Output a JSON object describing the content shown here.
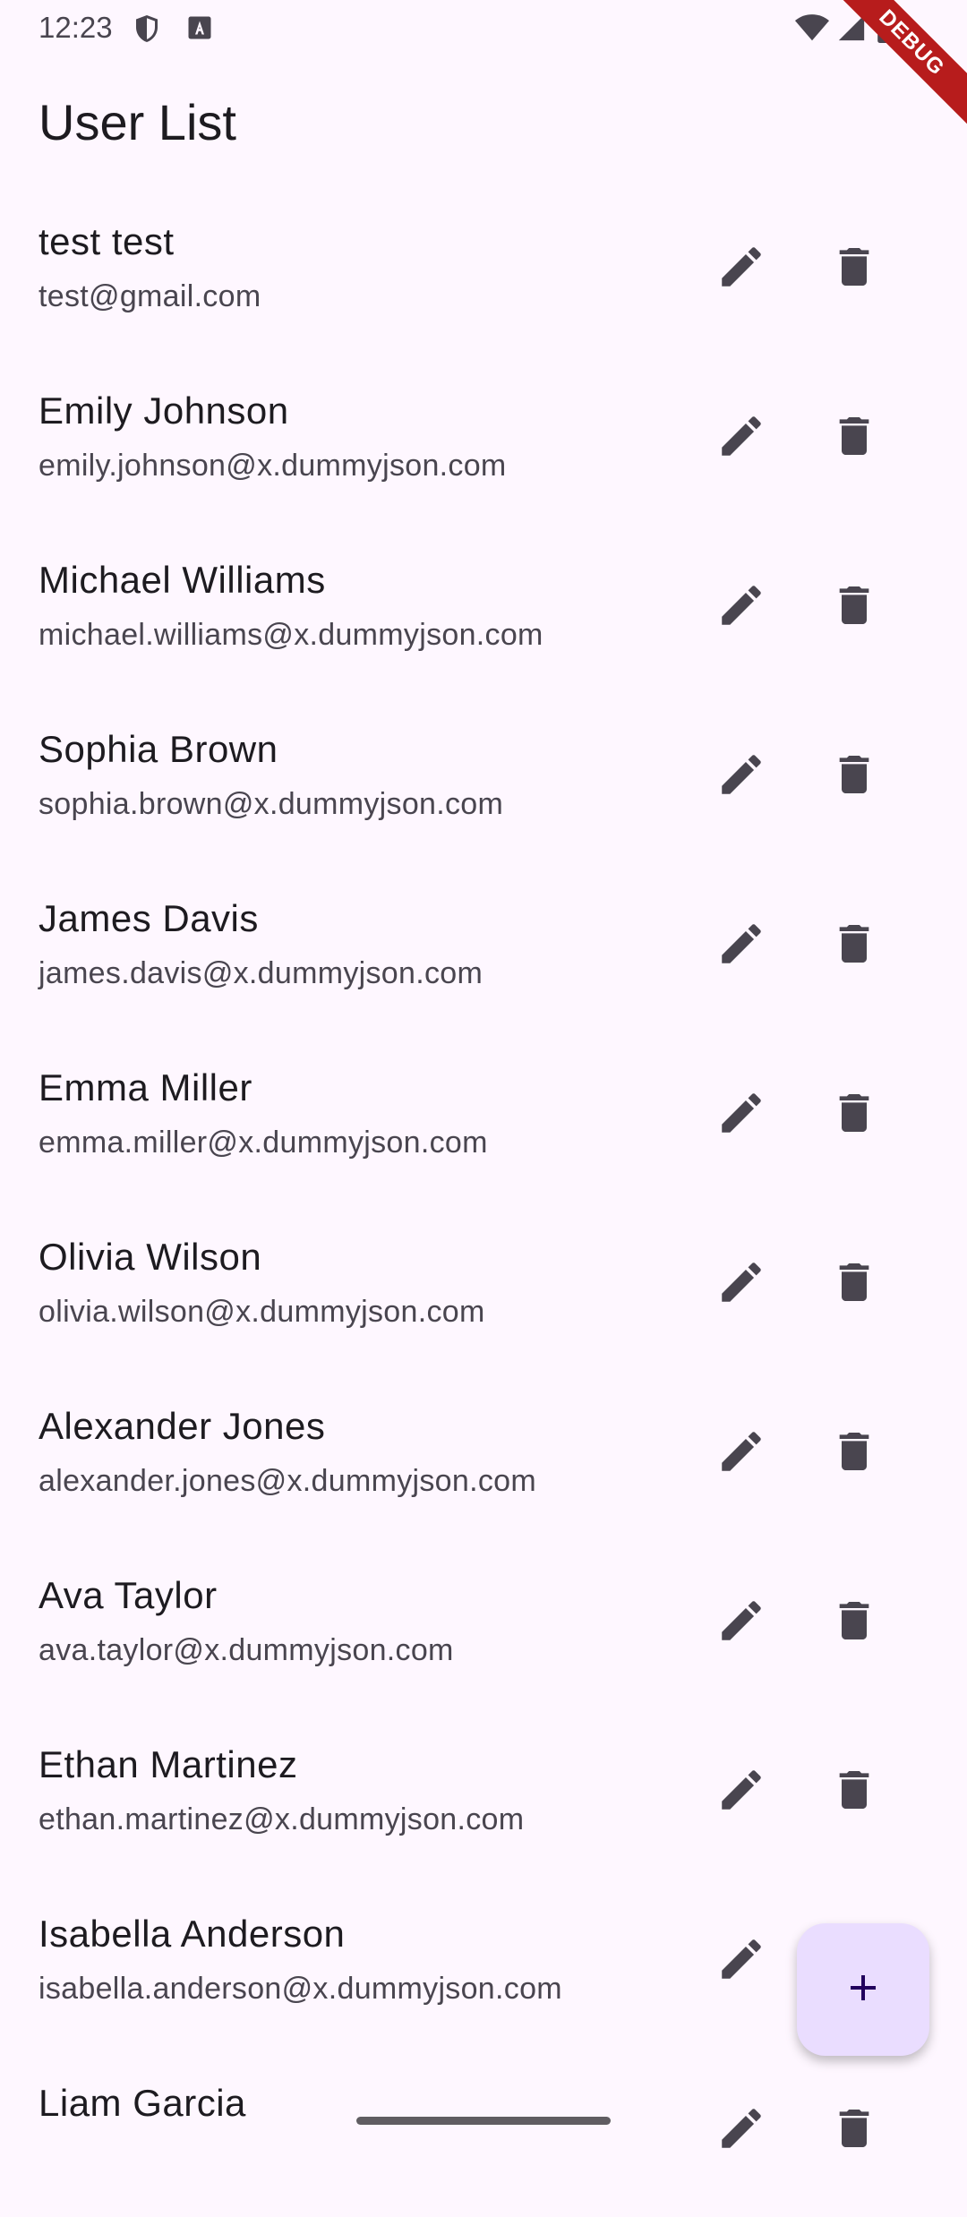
{
  "status_bar": {
    "time": "12:23",
    "debug_label": "DEBUG"
  },
  "app_bar": {
    "title": "User List"
  },
  "users": [
    {
      "name": "test test",
      "email": "test@gmail.com"
    },
    {
      "name": "Emily Johnson",
      "email": "emily.johnson@x.dummyjson.com"
    },
    {
      "name": "Michael Williams",
      "email": "michael.williams@x.dummyjson.com"
    },
    {
      "name": "Sophia Brown",
      "email": "sophia.brown@x.dummyjson.com"
    },
    {
      "name": "James Davis",
      "email": "james.davis@x.dummyjson.com"
    },
    {
      "name": "Emma Miller",
      "email": "emma.miller@x.dummyjson.com"
    },
    {
      "name": "Olivia Wilson",
      "email": "olivia.wilson@x.dummyjson.com"
    },
    {
      "name": "Alexander Jones",
      "email": "alexander.jones@x.dummyjson.com"
    },
    {
      "name": "Ava Taylor",
      "email": "ava.taylor@x.dummyjson.com"
    },
    {
      "name": "Ethan Martinez",
      "email": "ethan.martinez@x.dummyjson.com"
    },
    {
      "name": "Isabella Anderson",
      "email": "isabella.anderson@x.dummyjson.com"
    },
    {
      "name": "Liam Garcia",
      "email": ""
    }
  ],
  "icons": {
    "edit": "pencil-icon",
    "delete": "trash-icon",
    "fab": "plus-icon"
  },
  "colors": {
    "background": "#fef7ff",
    "fab": "#eaddff",
    "icon": "#49454f",
    "debug_ribbon": "#b71c1c"
  }
}
